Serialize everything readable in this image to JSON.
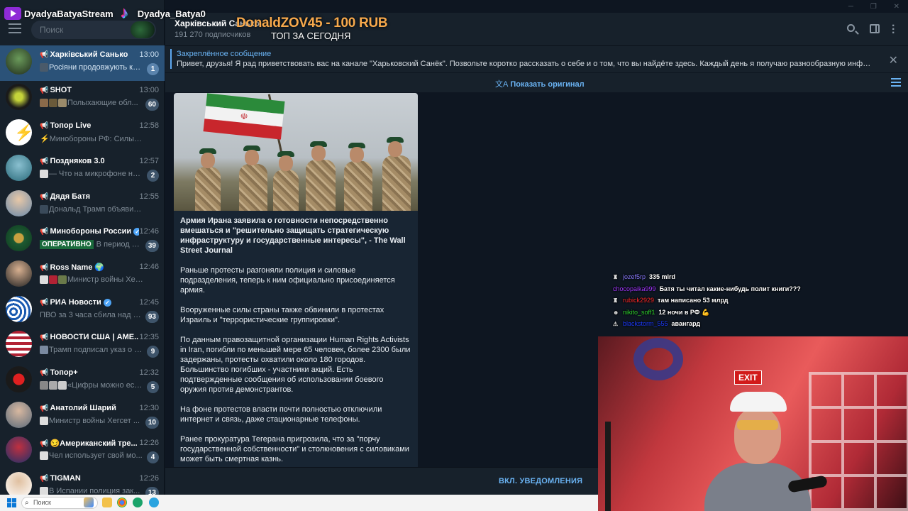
{
  "overlay": {
    "brand_youtube": "DyadyaBatyaStream",
    "brand_tiktok": "Dyadya_Batya0",
    "donation": "DonaldZOV45 - 100 RUB",
    "top_label": "ТОП ЗА СЕГОДНЯ"
  },
  "sidebar": {
    "search_placeholder": "Поиск",
    "chats": [
      {
        "name": "Харківський Санько",
        "time": "13:00",
        "preview": "Росіяни продовжують ко...",
        "badge": "1",
        "active": true
      },
      {
        "name": "SHOT",
        "time": "13:00",
        "preview": "Полыхающие обл...",
        "badge": "60"
      },
      {
        "name": "Топор Live",
        "time": "12:58",
        "preview": "⚡Минобороны РФ: Силы ПВО ..."
      },
      {
        "name": "Поздняков 3.0",
        "time": "12:57",
        "preview": "— Что на микрофоне на...",
        "badge": "2"
      },
      {
        "name": "Дядя Батя",
        "time": "12:55",
        "preview": "Дональд Трамп объявил о в..."
      },
      {
        "name": "Минобороны России",
        "time": "12:46",
        "preview": "В период с 20...",
        "badge": "39",
        "tag": "ОПЕРАТИВНО"
      },
      {
        "name": "Ross Name 🌍",
        "time": "12:46",
        "preview": "Министр войны Хегсе..."
      },
      {
        "name": "РИА Новости",
        "time": "12:45",
        "preview": "ПВО за 3 часа сбила над ро...",
        "badge": "93"
      },
      {
        "name": "НОВОСТИ США | АМЕ...",
        "time": "12:35",
        "preview": "Трамп подписал указ о з...",
        "badge": "9"
      },
      {
        "name": "Топор+",
        "time": "12:32",
        "preview": "«Цифры можно ест...",
        "badge": "5"
      },
      {
        "name": "Анатолий Шарий",
        "time": "12:30",
        "preview": "Министр войны Хегсет ...",
        "badge": "10"
      },
      {
        "name": "😏Американский тре...",
        "time": "12:26",
        "preview": "Чел использует свой мо...",
        "badge": "4"
      },
      {
        "name": "TIGMAN",
        "time": "12:26",
        "preview": "В Испании полиция зак...",
        "badge": "13"
      }
    ]
  },
  "header": {
    "title": "Харківський Санько",
    "subscribers": "191 270 подписчиков"
  },
  "pinned": {
    "title": "Закреплённое сообщение",
    "text": "Привет, друзья!  Я рад приветствовать вас на канале \"Харьковский Санёк\". Позвольте коротко рассказать о себе и о том, что вы найдёте здесь.  Каждый день я получаю разнообразную инфор..."
  },
  "translate": {
    "label": "Показать оригинал"
  },
  "post": {
    "lead": "Армия Ирана заявила о готовности непосредственно вмешаться и \"решительно защищать стратегическую инфраструктуру и государственные интересы\", - The Wall Street Journal",
    "p1": "Раньше протесты разгоняли полиция и силовые подразделения, теперь к ним официально присоединяется армия.",
    "p2": "Вооруженные силы страны также обвинили в протестах Израиль и \"террористические группировки\".",
    "p3": "По данным правозащитной организации Human Rights Activists in Iran, погибли по меньшей мере 65 человек, более 2300 были задержаны, протесты охватили около 180 городов. Большинство погибших - участники акций. Есть подтвержденные сообщения об использовании боевого оружия против демонстрантов.",
    "p4": "На фоне протестов власти почти полностью отключили интернет и связь, даже стационарные телефоны.",
    "p5": "Ранее прокуратура Тегерана пригрозила, что за \"порчу государственной собственности\" и столкновения с силовиками может быть смертная казнь."
  },
  "notify": {
    "label": "ВКЛ. УВЕДОМЛЕНИЯ"
  },
  "stream_chat": [
    {
      "user": "jozef5rp",
      "msg": "335 mlrd",
      "color": "#8a7bff"
    },
    {
      "user": "chocopaika999",
      "msg": "Батя ты читал какие-нибудь полит книги???",
      "color": "#a238ff"
    },
    {
      "user": "rubick2929",
      "msg": "там написано 53 млрд",
      "color": "#ff2a2a"
    },
    {
      "user": "nikito_soff1",
      "msg": "12 ночи в РФ 💪",
      "color": "#2fd12f"
    },
    {
      "user": "blackstorm_555",
      "msg": "авангард",
      "color": "#1d3cff"
    }
  ],
  "webcam": {
    "exit_sign": "EXIT"
  },
  "taskbar": {
    "search_placeholder": "Поиск"
  },
  "colors": {
    "accent": "#6ab3f3",
    "active_chat": "#2b5278",
    "sidebar_bg": "#17212b",
    "chat_bg": "#0e1621",
    "bubble_bg": "#182533"
  }
}
